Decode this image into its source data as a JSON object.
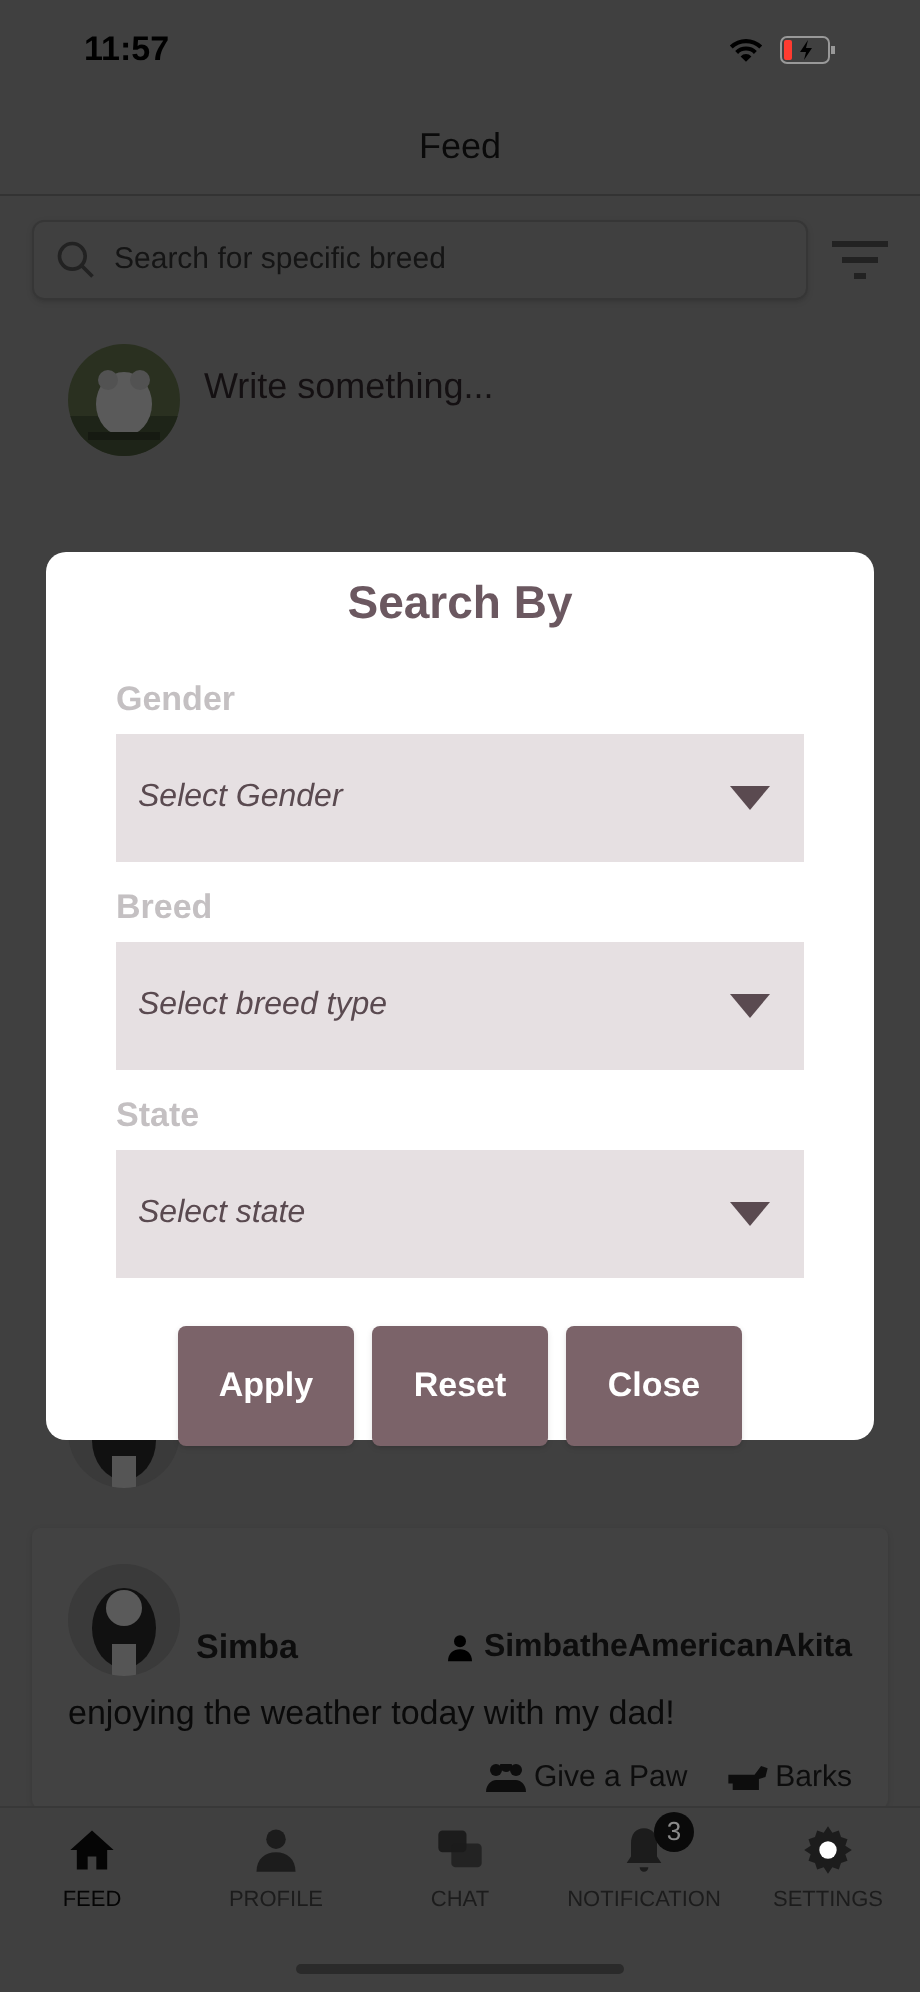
{
  "status_bar": {
    "time": "11:57"
  },
  "header": {
    "title": "Feed"
  },
  "search": {
    "placeholder": "Search for specific breed"
  },
  "composer": {
    "placeholder": "Write something..."
  },
  "post": {
    "author": "Simba",
    "username": "SimbatheAmericanAkita",
    "text": "enjoying the weather today with my dad!",
    "actions": [
      {
        "kind": "paw",
        "label": "Give a Paw"
      },
      {
        "kind": "bark",
        "label": "Barks"
      }
    ]
  },
  "dialog": {
    "title": "Search By",
    "filters": [
      {
        "label": "Gender",
        "placeholder": "Select Gender"
      },
      {
        "label": "Breed",
        "placeholder": "Select breed type"
      },
      {
        "label": "State",
        "placeholder": "Select state"
      }
    ],
    "buttons": [
      "Apply",
      "Reset",
      "Close"
    ]
  },
  "tab_bar": [
    {
      "kind": "home",
      "label": "FEED",
      "selected": true
    },
    {
      "kind": "person",
      "label": "PROFILE",
      "selected": false
    },
    {
      "kind": "chat",
      "label": "CHAT",
      "selected": false
    },
    {
      "kind": "bell",
      "label": "NOTIFICATION",
      "selected": false,
      "badge": "3"
    },
    {
      "kind": "gear",
      "label": "SETTINGS",
      "selected": false
    }
  ]
}
